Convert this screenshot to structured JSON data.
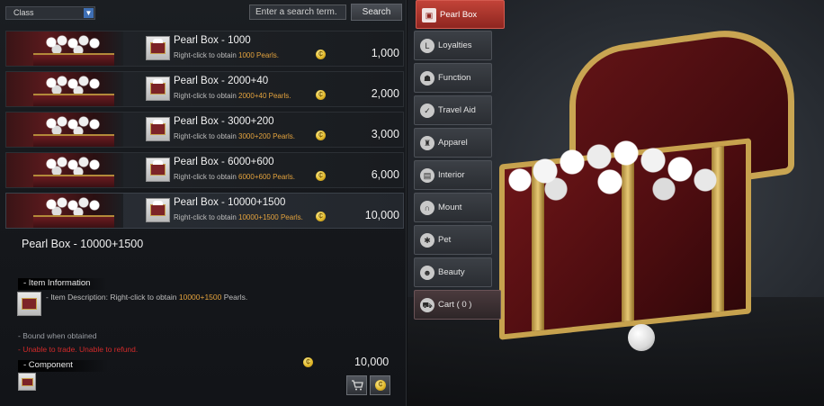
{
  "toolbar": {
    "class_select": "Class",
    "search_placeholder": "Enter a search term.",
    "search_button": "Search"
  },
  "items": [
    {
      "name": "Pearl Box - 1000",
      "desc_prefix": "Right-click to obtain ",
      "desc_highlight": "1000 Pearls.",
      "price": "1,000"
    },
    {
      "name": "Pearl Box - 2000+40",
      "desc_prefix": "Right-click to obtain ",
      "desc_highlight": "2000+40 Pearls.",
      "price": "2,000"
    },
    {
      "name": "Pearl Box - 3000+200",
      "desc_prefix": "Right-click to obtain ",
      "desc_highlight": "3000+200 Pearls.",
      "price": "3,000"
    },
    {
      "name": "Pearl Box - 6000+600",
      "desc_prefix": "Right-click to obtain ",
      "desc_highlight": "6000+600 Pearls.",
      "price": "6,000"
    },
    {
      "name": "Pearl Box - 10000+1500",
      "desc_prefix": "Right-click to obtain ",
      "desc_highlight": "10000+1500 Pearls.",
      "price": "10,000"
    }
  ],
  "detail": {
    "title": "Pearl Box - 10000+1500",
    "item_info_label": "- Item Information",
    "desc_prefix": "- Item Description: Right-click to obtain ",
    "desc_highlight": "10000+1500",
    "desc_suffix": " Pearls.",
    "bound_text": "- Bound when obtained",
    "restrict_text": "- Unable to trade. Unable to refund.",
    "component_label": "- Component",
    "price": "10,000"
  },
  "tabs": [
    {
      "label": "Pearl Box",
      "icon": "pearl-box-icon"
    },
    {
      "label": "Loyalties",
      "icon": "loyalty-icon"
    },
    {
      "label": "Function",
      "icon": "function-icon"
    },
    {
      "label": "Travel Aid",
      "icon": "thumbs-up-icon"
    },
    {
      "label": "Apparel",
      "icon": "apparel-icon"
    },
    {
      "label": "Interior",
      "icon": "interior-icon"
    },
    {
      "label": "Mount",
      "icon": "horseshoe-icon"
    },
    {
      "label": "Pet",
      "icon": "paw-icon"
    },
    {
      "label": "Beauty",
      "icon": "beauty-icon"
    },
    {
      "label": "Cart ( 0 )",
      "icon": "cart-icon"
    }
  ],
  "colors": {
    "accent_red": "#b63a30",
    "price_gold": "#e3a23d",
    "warning_red": "#d22a2a"
  }
}
